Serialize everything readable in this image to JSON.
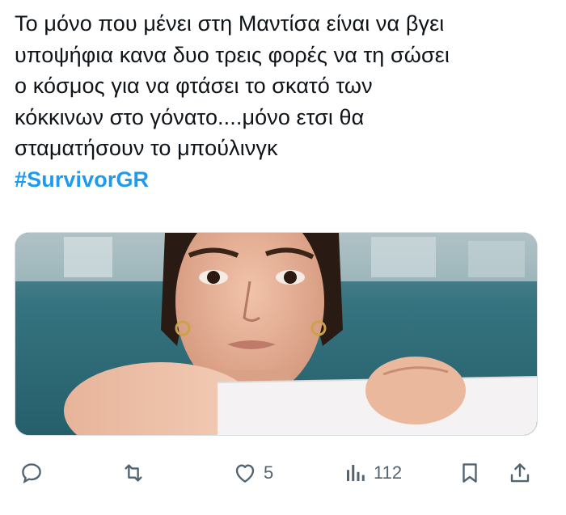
{
  "tweet": {
    "lines": [
      "Το μόνο που μένει στη Μαντίσα είναι να βγει",
      "υποψήφια κανα δυο τρεις φορές να τη σώσει",
      "ο κόσμος για να φτάσει το σκατό των",
      "κόκκινων στο γόνατο....μόνο ετσι θα",
      "σταματήσουν το μπούλινγκ"
    ],
    "hashtag": "#SurvivorGR"
  },
  "media": {
    "description_icon": "photo",
    "accent": "#2e6a78"
  },
  "actions": {
    "reply": {
      "icon": "reply-icon"
    },
    "retweet": {
      "icon": "retweet-icon"
    },
    "like": {
      "icon": "heart-icon",
      "count": "5"
    },
    "views": {
      "icon": "views-icon",
      "count": "112"
    },
    "bookmark": {
      "icon": "bookmark-icon"
    },
    "share": {
      "icon": "share-icon"
    }
  },
  "colors": {
    "hashtag": "#1d9bf0",
    "icon": "#536471",
    "text": "#0f1419"
  }
}
